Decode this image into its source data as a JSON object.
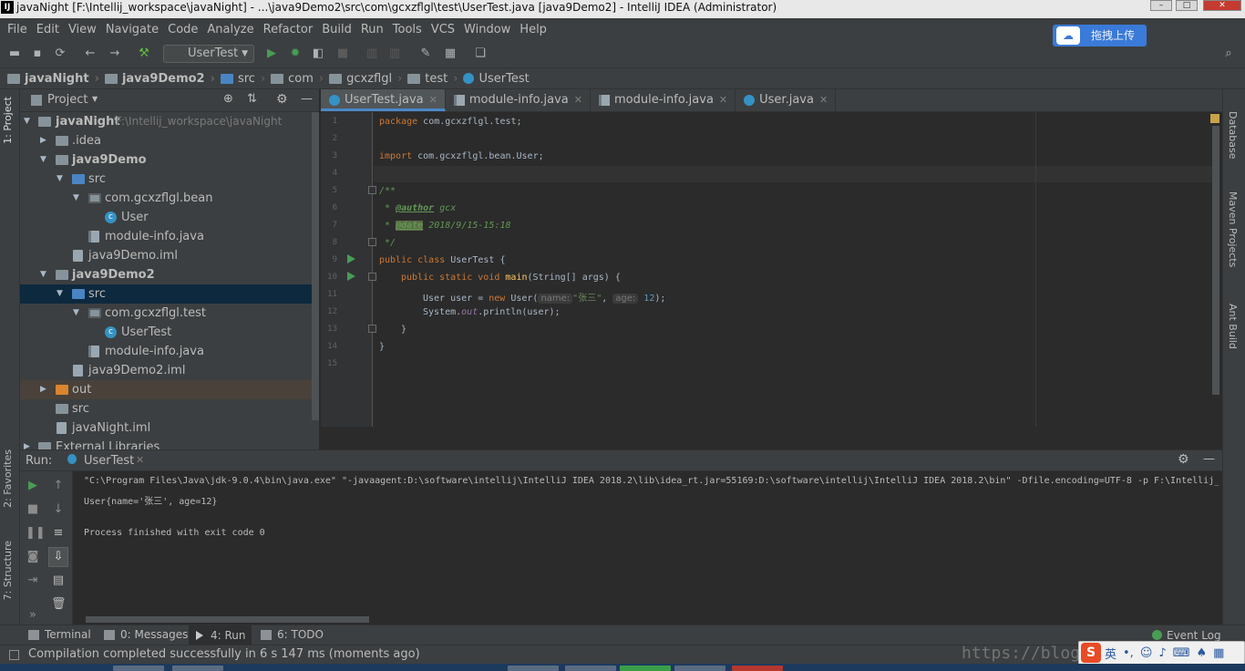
{
  "window": {
    "title": "javaNight [F:\\Intellij_workspace\\javaNight] - ...\\java9Demo2\\src\\com\\gcxzflgl\\test\\UserTest.java [java9Demo2] - IntelliJ IDEA (Administrator)",
    "logo": "IJ"
  },
  "menu": [
    "File",
    "Edit",
    "View",
    "Navigate",
    "Code",
    "Analyze",
    "Refactor",
    "Build",
    "Run",
    "Tools",
    "VCS",
    "Window",
    "Help"
  ],
  "toolbar": {
    "run_config": "UserTest",
    "upload_label": "拖拽上传"
  },
  "breadcrumb": [
    "javaNight",
    "java9Demo2",
    "src",
    "com",
    "gcxzflgl",
    "test",
    "UserTest"
  ],
  "project_panel": {
    "title": "Project",
    "tree": [
      {
        "label": "javaNight",
        "path": "F:\\Intellij_workspace\\javaNight"
      },
      {
        "label": ".idea"
      },
      {
        "label": "java9Demo"
      },
      {
        "label": "src"
      },
      {
        "label": "com.gcxzflgl.bean"
      },
      {
        "label": "User"
      },
      {
        "label": "module-info.java"
      },
      {
        "label": "java9Demo.iml"
      },
      {
        "label": "java9Demo2"
      },
      {
        "label": "src"
      },
      {
        "label": "com.gcxzflgl.test"
      },
      {
        "label": "UserTest"
      },
      {
        "label": "module-info.java"
      },
      {
        "label": "java9Demo2.iml"
      },
      {
        "label": "out"
      },
      {
        "label": "src"
      },
      {
        "label": "javaNight.iml"
      },
      {
        "label": "External Libraries"
      }
    ]
  },
  "editor_tabs": [
    "UserTest.java",
    "module-info.java",
    "module-info.java",
    "User.java"
  ],
  "code": {
    "line_numbers": [
      "1",
      "2",
      "3",
      "4",
      "5",
      "6",
      "7",
      "8",
      "9",
      "10",
      "11",
      "12",
      "13",
      "14",
      "15"
    ],
    "l1_kw": "package",
    "l1_rest": " com.gcxzflgl.test;",
    "l3_kw": "import",
    "l3_rest": " com.gcxzflgl.bean.User;",
    "l5": "/**",
    "l6_star": " * ",
    "l6_tag": "@author",
    "l6_val": " gcx",
    "l7_star": " * ",
    "l7_tag": "@date",
    "l7_val": " 2018/9/15-15:18",
    "l8": " */",
    "l9_kw": "public class",
    "l9_rest": " UserTest {",
    "l10_kw": "public static void",
    "l10_fn": "main",
    "l10_rest": "(String[] args) {",
    "l11_a": "User user = ",
    "l11_new": "new",
    "l11_b": " User(",
    "l11_hint1": "name:",
    "l11_str": "\"张三\"",
    "l11_c": ", ",
    "l11_hint2": "age:",
    "l11_num": "12",
    "l11_d": ");",
    "l12_a": "System.",
    "l12_field": "out",
    "l12_b": ".println(user);",
    "l13": "}",
    "l14": "}"
  },
  "run_panel": {
    "label": "Run:",
    "tab": "UserTest",
    "console": [
      "\"C:\\Program Files\\Java\\jdk-9.0.4\\bin\\java.exe\" \"-javaagent:D:\\software\\intellij\\IntelliJ IDEA 2018.2\\lib\\idea_rt.jar=55169:D:\\software\\intellij\\IntelliJ IDEA 2018.2\\bin\" -Dfile.encoding=UTF-8 -p F:\\Intellij_w",
      "User{name='张三', age=12}",
      "",
      "Process finished with exit code 0"
    ]
  },
  "bottom_tabs": [
    {
      "label": "Terminal"
    },
    {
      "label": "0: Messages"
    },
    {
      "label": "4: Run"
    },
    {
      "label": "6: TODO"
    }
  ],
  "event_log": "Event Log",
  "status": "Compilation completed successfully in 6 s 147 ms (moments ago)",
  "side_tabs": {
    "left": [
      "1: Project",
      "2: Favorites",
      "7: Structure"
    ],
    "right": [
      "Database",
      "Maven Projects",
      "Ant Build"
    ]
  },
  "watermark": "https://blog.",
  "ime": {
    "logo": "S",
    "mode": "英"
  }
}
